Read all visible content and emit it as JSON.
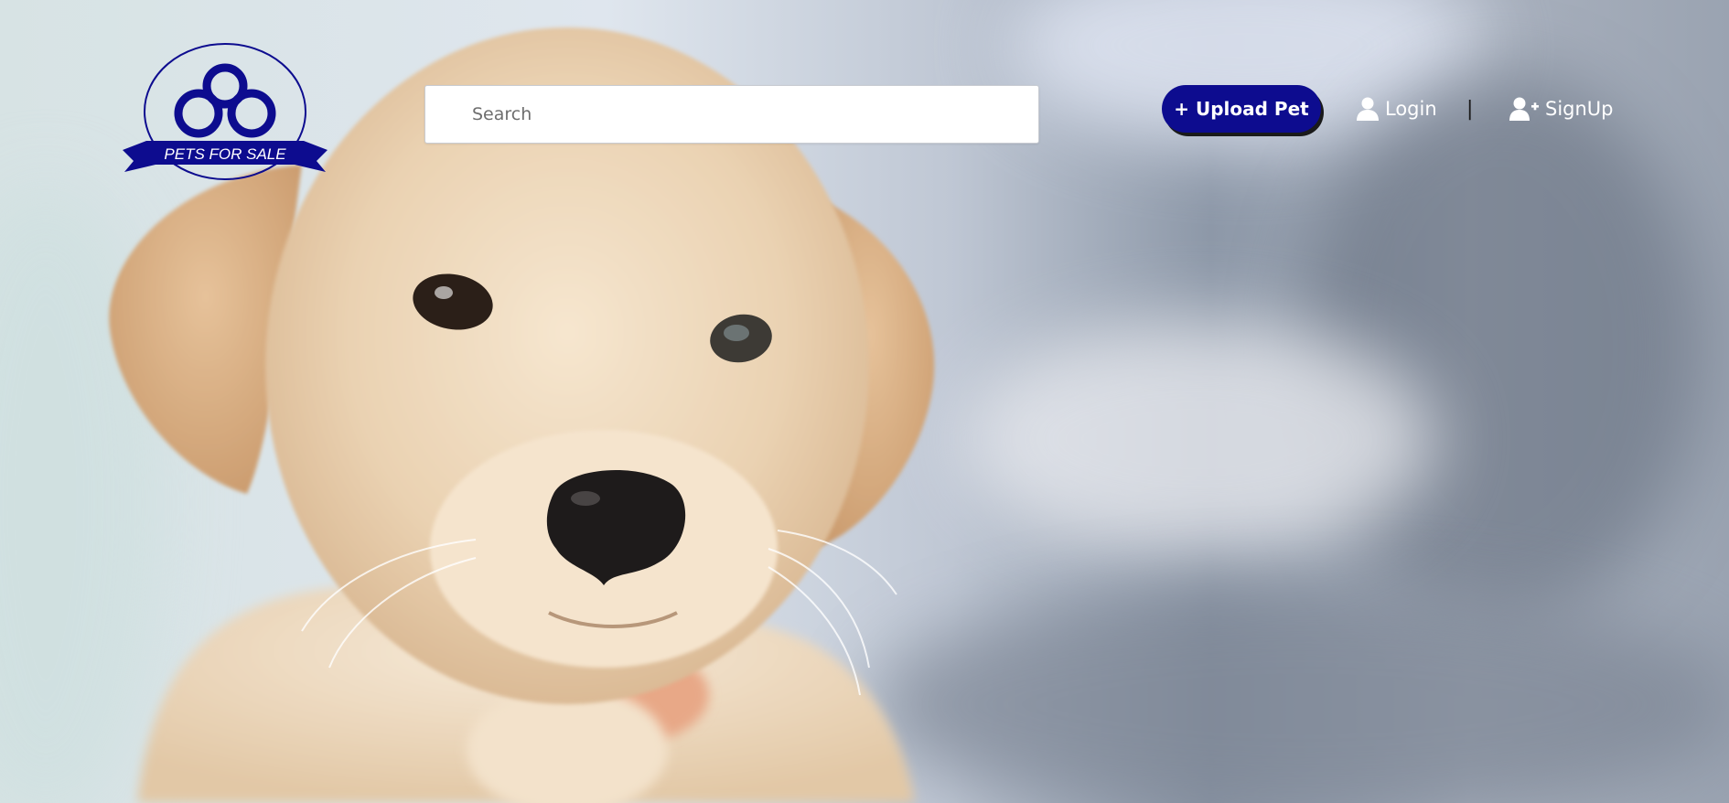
{
  "brand": {
    "logo_text": "PETS FOR SALE",
    "brand_color": "#0d0c8f",
    "logo_icon": "clover-icon"
  },
  "search": {
    "placeholder": "Search",
    "value": ""
  },
  "header": {
    "upload_label": "+ Upload Pet",
    "login_label": "Login",
    "separator": "|",
    "signup_label": "SignUp",
    "login_icon": "user-icon",
    "signup_icon": "user-plus-icon"
  },
  "hero": {
    "image_subject": "puppy-photo"
  }
}
